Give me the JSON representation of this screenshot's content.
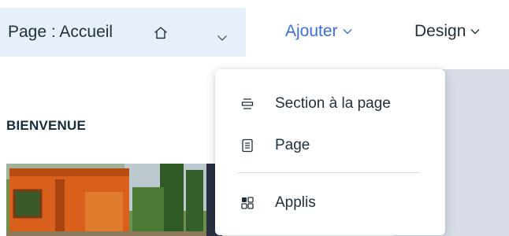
{
  "header": {
    "page_selector_label": "Page : Accueil",
    "page_selector_icon": "home-icon",
    "add_label": "Ajouter",
    "design_label": "Design",
    "accent_color": "#3b6fd8"
  },
  "canvas": {
    "welcome_heading": "BIENVENUE"
  },
  "add_menu": {
    "items": [
      {
        "label": "Section à la page",
        "icon": "section-icon"
      },
      {
        "label": "Page",
        "icon": "page-icon"
      },
      {
        "label": "Applis",
        "icon": "apps-icon"
      }
    ]
  }
}
